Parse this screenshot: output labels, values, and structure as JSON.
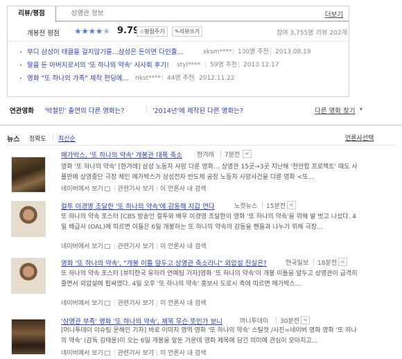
{
  "tabs": {
    "review": "리뷰/평점",
    "info": "상영관 정보",
    "more": "더보기"
  },
  "rating": {
    "label": "개봉전 평점",
    "stars": 4.5,
    "score": "9.79",
    "rate_btn": "☆평점주기",
    "write_btn": "✎리뷰쓰기",
    "participants": "참여 3,755명",
    "reviews": "리뷰 202개"
  },
  "reviews": [
    {
      "title": "부디 삼성이 태클을 걸지않기를...삼성은 돈이면 다인줄...",
      "author": "sksm****",
      "recommend": "130명 추천",
      "date": "2013.08.19"
    },
    {
      "title": "딸을 둔 아버지로서의 '또 하나의 약속' 시사회 후기!",
      "author": "styl****",
      "recommend": "59명 추천",
      "date": "2013.12.17"
    },
    {
      "title": "영화 \"또 하나의 가족\" 제작 펀딩에...",
      "author": "nkst****",
      "recommend": "44명 추천",
      "date": "2012.11.22"
    }
  ],
  "related": {
    "label": "연관영화",
    "link1": "'박철민' 출연의 다른 영화는?",
    "link2": "'2014년'에 제작된 다른 영화는?",
    "other": "다른 영화 찾기"
  },
  "news": {
    "title": "뉴스",
    "sort_accuracy": "정확도",
    "sort_latest": "최신순",
    "press_select": "언론사선택",
    "items": [
      {
        "headline": "메가박스, '또 하나의 약속' 개봉관 대폭 축소",
        "press": "한겨레",
        "time": "7분전",
        "summary": "영화 '또 하나의 약속' [한겨레] 삼성 노동자 사망 다룬 영화… 상영관 15곳→3곳 지난해 '천안함 프로젝트' 때도 사플만에 상영중단 극장 체인 메가박스가 삼성전자 반도체 공장 노동자 사망사건을 다룬 영화 <또...",
        "act_naver": "네이버에서 보기",
        "act_related": "관련기사 보기",
        "act_press": "이 언론사 내 검색"
      },
      {
        "headline": "컬투 이경영 조달한 '또 하나의 약속'에 감동해 지갑 연다",
        "press": "노컷뉴스",
        "time": "15분전",
        "summary": "또 하나의 약속 포스터 [CBS 방송인 컬투와 배우 이경영 조달한이 영화 '또 하나의 약속'을 위해 발 벗고 나섰다. 4일 배급사 (OAL)에 따르면 이들은 6일 개봉하는 또 하나의 약속의 감동을 팬들과 나누기 위해 극장...",
        "act_naver": "네이버에서 보기",
        "act_related": "관련기사 보기",
        "act_press": "이 언론사 내 검색"
      },
      {
        "headline": "영화 '또 하나의 약속', \"개봉 이틀 앞두고 상영관 축소라니\" 외압설 진실은?",
        "press": "한국일보",
        "time": "18분전",
        "summary": "또 하나의 약속 포스터 [뷰티한국 유하라 연예팀 기자]영화 '또 하나의 약속'이 개봉 이틀을 앞두고 상영관이 급격히 줄면서 외압설에 휩싸였다. 4일 오후 '또 하나의 약속' 홍보사 도로시 측에 따르면 메가박스...",
        "act_naver": "네이버에서 보기",
        "act_related": "관련기사 보기",
        "act_press": "이 언론사 내 검색"
      },
      {
        "headline": "'삼영관 부족' 영화 '또 하나의 약속', 제목 무슨 뜻인가 보니",
        "press": "머니투데이",
        "time": "30분전",
        "summary": "[머니투데이 이슈팀 문해인 기자] 바로 이미지 영역 영화 '또 하나의 약속' 스틸컷 /사진=네이버 영화 영화 '또 하나의 약속' (감독 김태윤)이 오는 6일 개봉을 앞둔 가운데 영화 제목에 담긴 의미에 관심이 모아지고...",
        "act_naver": "네이버에서 보기",
        "act_related": "관련기사 보기",
        "act_press": "이 언론사 내 검색"
      }
    ]
  }
}
